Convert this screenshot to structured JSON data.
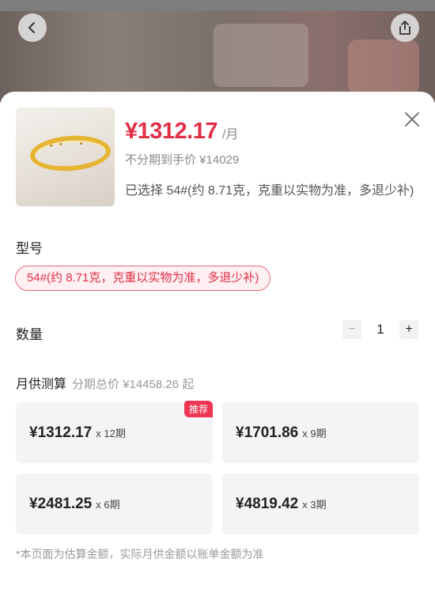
{
  "product": {
    "monthly_price": "¥1312.17",
    "per_unit": "/月",
    "full_price_text": "不分期到手价 ¥14029",
    "selected_text": "已选择 54#(约 8.71克，克重以实物为准，多退少补)"
  },
  "model": {
    "label": "型号",
    "option": "54#(约 8.71克，克重以实物为准，多退少补)"
  },
  "quantity": {
    "label": "数量",
    "value": "1",
    "minus": "−",
    "plus": "+"
  },
  "installment": {
    "title": "月供测算",
    "total_text": "分期总价 ¥14458.26 起",
    "recommend_badge": "推荐",
    "plans": [
      {
        "amount": "¥1312.17",
        "term": "x 12期"
      },
      {
        "amount": "¥1701.86",
        "term": "x 9期"
      },
      {
        "amount": "¥2481.25",
        "term": "x 6期"
      },
      {
        "amount": "¥4819.42",
        "term": "x 3期"
      }
    ]
  },
  "footnote": "*本页面为估算金额，实际月供金额以账单金额为准",
  "icons": {
    "back": "chevron-left-icon",
    "share": "share-icon",
    "close": "close-icon"
  },
  "colors": {
    "accent": "#e02e45",
    "badge": "#ee3654",
    "plan_bg": "#f4f4f6"
  }
}
